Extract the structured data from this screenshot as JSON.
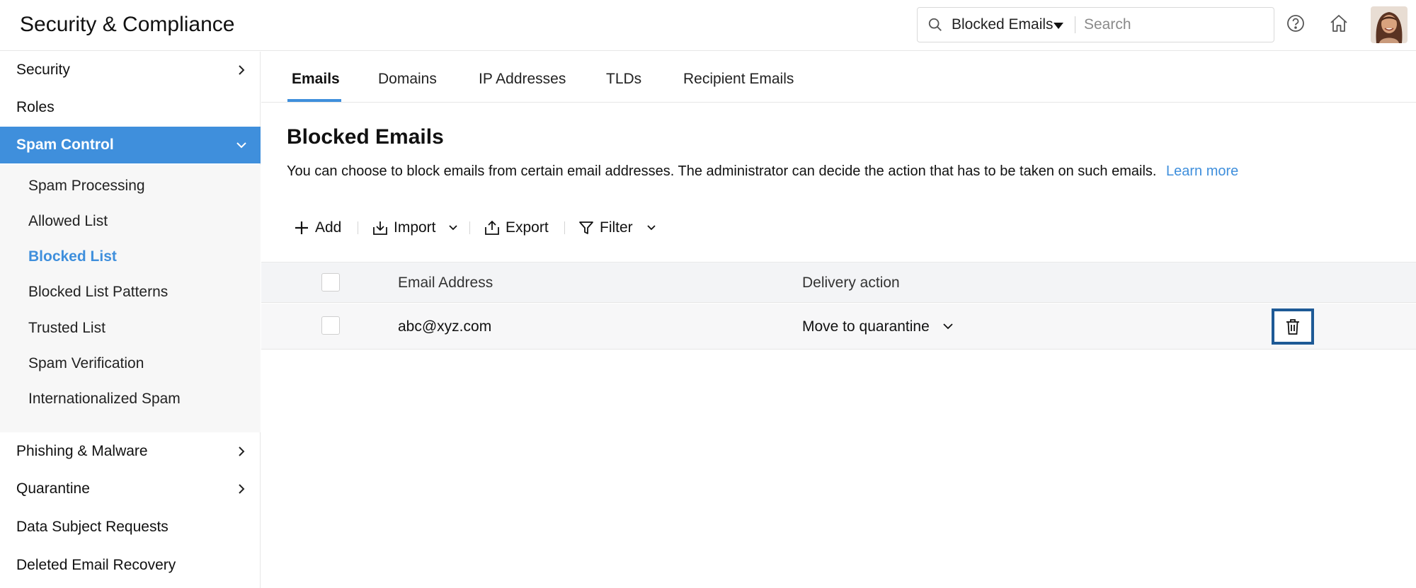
{
  "header": {
    "app_title": "Security & Compliance",
    "search_scope": "Blocked Emails",
    "search_placeholder": "Search"
  },
  "sidebar": {
    "items": [
      {
        "label": "Security",
        "has_chevron": true
      },
      {
        "label": "Roles",
        "has_chevron": false
      },
      {
        "label": "Spam Control",
        "has_chevron": true,
        "expanded": true,
        "active": true
      },
      {
        "label": "Phishing & Malware",
        "has_chevron": true
      },
      {
        "label": "Quarantine",
        "has_chevron": true
      },
      {
        "label": "Data Subject Requests",
        "has_chevron": false
      },
      {
        "label": "Deleted Email Recovery",
        "has_chevron": false
      }
    ],
    "spam_control_subitems": [
      {
        "label": "Spam Processing"
      },
      {
        "label": "Allowed List"
      },
      {
        "label": "Blocked List",
        "selected": true
      },
      {
        "label": "Blocked List Patterns"
      },
      {
        "label": "Trusted List"
      },
      {
        "label": "Spam Verification"
      },
      {
        "label": "Internationalized Spam"
      }
    ]
  },
  "tabs": [
    {
      "label": "Emails",
      "active": true
    },
    {
      "label": "Domains"
    },
    {
      "label": "IP Addresses"
    },
    {
      "label": "TLDs"
    },
    {
      "label": "Recipient Emails"
    }
  ],
  "main": {
    "title": "Blocked Emails",
    "description": "You can choose to block emails from certain email addresses. The administrator can decide the action that has to be taken on such emails.",
    "learn_more": "Learn more"
  },
  "toolbar": {
    "add_label": "Add",
    "import_label": "Import",
    "export_label": "Export",
    "filter_label": "Filter"
  },
  "table": {
    "columns": [
      "Email Address",
      "Delivery action"
    ],
    "rows": [
      {
        "email": "abc@xyz.com",
        "delivery_action": "Move to quarantine"
      }
    ]
  },
  "colors": {
    "accent": "#3f8fdc",
    "delete_focus": "#1e5a96"
  }
}
